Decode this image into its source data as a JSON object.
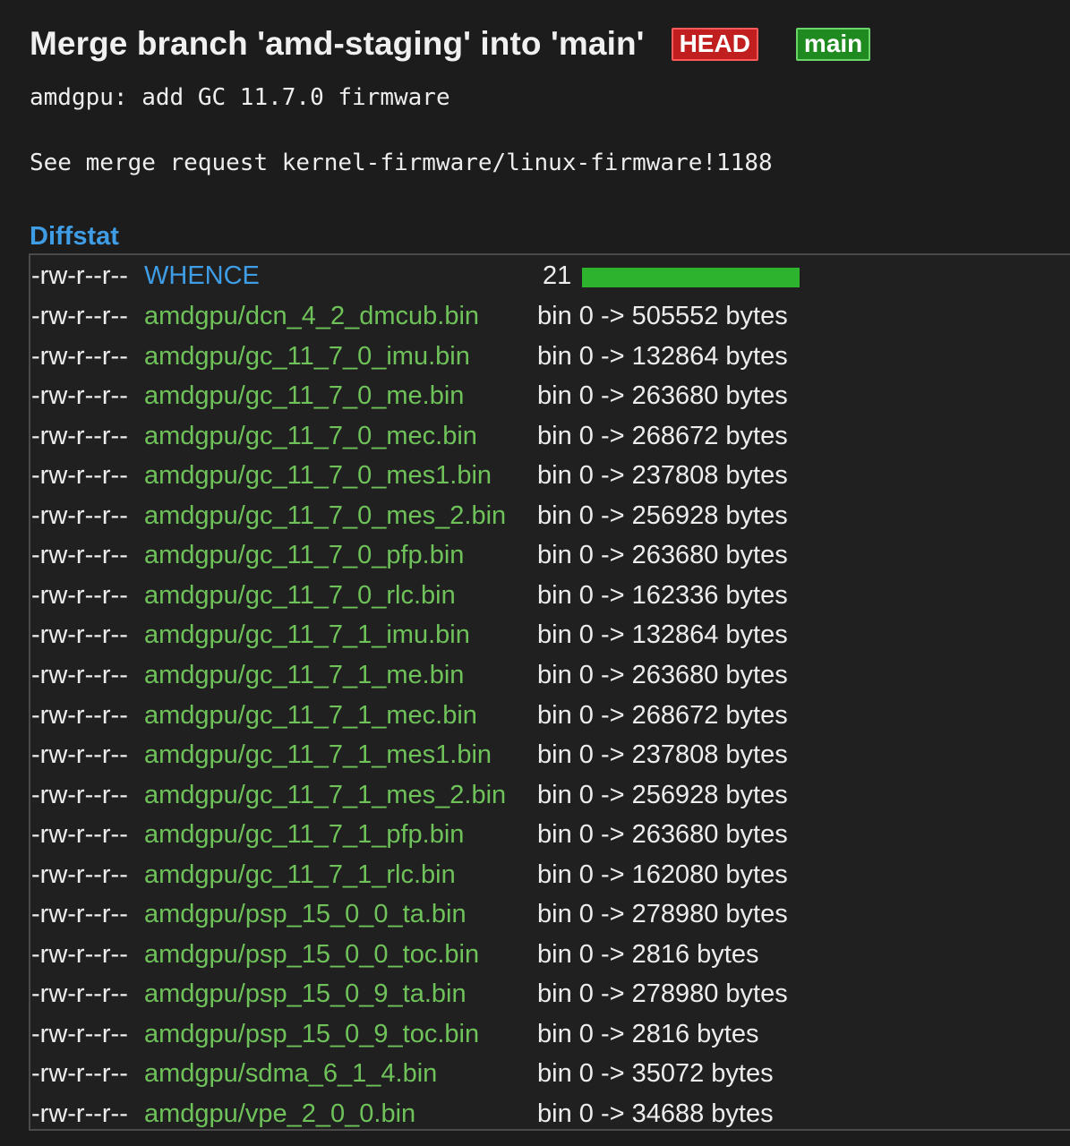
{
  "commit": {
    "title": "Merge branch 'amd-staging' into 'main'",
    "refs": [
      {
        "label": "HEAD",
        "color": "#c11f1f"
      },
      {
        "label": "main",
        "color": "#1f8a1f"
      }
    ],
    "message_lines": [
      "amdgpu: add GC 11.7.0 firmware",
      "See merge request kernel-firmware/linux-firmware!1188"
    ]
  },
  "diffstat": {
    "heading": "Diffstat",
    "modified_file": {
      "mode": "-rw-r--r--",
      "name": "WHENCE",
      "changes": "21",
      "bar_fraction": 1.0
    },
    "binary_files": [
      {
        "mode": "-rw-r--r--",
        "name": "amdgpu/dcn_4_2_dmcub.bin",
        "stat": "bin 0 -> 505552 bytes"
      },
      {
        "mode": "-rw-r--r--",
        "name": "amdgpu/gc_11_7_0_imu.bin",
        "stat": "bin 0 -> 132864 bytes"
      },
      {
        "mode": "-rw-r--r--",
        "name": "amdgpu/gc_11_7_0_me.bin",
        "stat": "bin 0 -> 263680 bytes"
      },
      {
        "mode": "-rw-r--r--",
        "name": "amdgpu/gc_11_7_0_mec.bin",
        "stat": "bin 0 -> 268672 bytes"
      },
      {
        "mode": "-rw-r--r--",
        "name": "amdgpu/gc_11_7_0_mes1.bin",
        "stat": "bin 0 -> 237808 bytes"
      },
      {
        "mode": "-rw-r--r--",
        "name": "amdgpu/gc_11_7_0_mes_2.bin",
        "stat": "bin 0 -> 256928 bytes"
      },
      {
        "mode": "-rw-r--r--",
        "name": "amdgpu/gc_11_7_0_pfp.bin",
        "stat": "bin 0 -> 263680 bytes"
      },
      {
        "mode": "-rw-r--r--",
        "name": "amdgpu/gc_11_7_0_rlc.bin",
        "stat": "bin 0 -> 162336 bytes"
      },
      {
        "mode": "-rw-r--r--",
        "name": "amdgpu/gc_11_7_1_imu.bin",
        "stat": "bin 0 -> 132864 bytes"
      },
      {
        "mode": "-rw-r--r--",
        "name": "amdgpu/gc_11_7_1_me.bin",
        "stat": "bin 0 -> 263680 bytes"
      },
      {
        "mode": "-rw-r--r--",
        "name": "amdgpu/gc_11_7_1_mec.bin",
        "stat": "bin 0 -> 268672 bytes"
      },
      {
        "mode": "-rw-r--r--",
        "name": "amdgpu/gc_11_7_1_mes1.bin",
        "stat": "bin 0 -> 237808 bytes"
      },
      {
        "mode": "-rw-r--r--",
        "name": "amdgpu/gc_11_7_1_mes_2.bin",
        "stat": "bin 0 -> 256928 bytes"
      },
      {
        "mode": "-rw-r--r--",
        "name": "amdgpu/gc_11_7_1_pfp.bin",
        "stat": "bin 0 -> 263680 bytes"
      },
      {
        "mode": "-rw-r--r--",
        "name": "amdgpu/gc_11_7_1_rlc.bin",
        "stat": "bin 0 -> 162080 bytes"
      },
      {
        "mode": "-rw-r--r--",
        "name": "amdgpu/psp_15_0_0_ta.bin",
        "stat": "bin 0 -> 278980 bytes"
      },
      {
        "mode": "-rw-r--r--",
        "name": "amdgpu/psp_15_0_0_toc.bin",
        "stat": "bin 0 -> 2816 bytes"
      },
      {
        "mode": "-rw-r--r--",
        "name": "amdgpu/psp_15_0_9_ta.bin",
        "stat": "bin 0 -> 278980 bytes"
      },
      {
        "mode": "-rw-r--r--",
        "name": "amdgpu/psp_15_0_9_toc.bin",
        "stat": "bin 0 -> 2816 bytes"
      },
      {
        "mode": "-rw-r--r--",
        "name": "amdgpu/sdma_6_1_4.bin",
        "stat": "bin 0 -> 35072 bytes"
      },
      {
        "mode": "-rw-r--r--",
        "name": "amdgpu/vpe_2_0_0.bin",
        "stat": "bin 0 -> 34688 bytes"
      }
    ]
  },
  "colors": {
    "added_file": "#6fc25a",
    "modified_file": "#3f9de6",
    "diff_bar": "#2eb32e"
  }
}
